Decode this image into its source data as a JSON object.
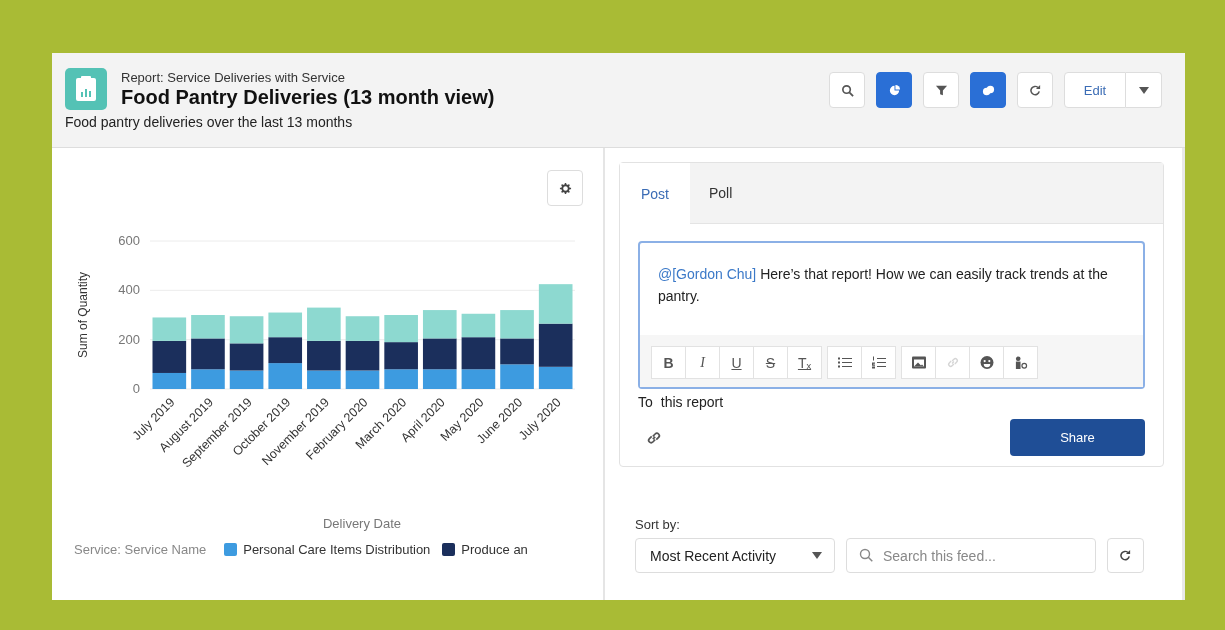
{
  "header": {
    "object_type": "Report: Service Deliveries with Service",
    "title": "Food Pantry Deliveries (13 month view)",
    "description": "Food pantry deliveries over the last 13 months"
  },
  "toolbar": [
    {
      "kind": "search",
      "selected": false
    },
    {
      "kind": "chart",
      "selected": true
    },
    {
      "kind": "filter",
      "selected": false
    },
    {
      "kind": "shapes",
      "selected": true
    },
    {
      "kind": "refresh",
      "selected": false
    }
  ],
  "edit_button": {
    "label": "Edit"
  },
  "chart_panel": {
    "chart_data": {
      "type": "bar",
      "stacked": true,
      "legend": {
        "title": "Service: Service Name"
      },
      "xlabel": "Delivery Date",
      "ylabel": "Sum of Quantity",
      "ylim": [
        0,
        600
      ],
      "yticks": [
        0,
        200,
        400,
        600
      ],
      "categories": [
        "July 2019",
        "August 2019",
        "September 2019",
        "October 2019",
        "November 2019",
        "February 2020",
        "March 2020",
        "April 2020",
        "May 2020",
        "June 2020",
        "July 2020"
      ],
      "series": [
        {
          "name": "Personal Care Items Distribution",
          "color": "#3d9be0",
          "values": [
            65,
            80,
            75,
            105,
            75,
            75,
            80,
            80,
            80,
            100,
            90
          ]
        },
        {
          "name": "Produce an",
          "color": "#1b2f5c",
          "values": [
            130,
            125,
            110,
            105,
            120,
            120,
            110,
            125,
            130,
            105,
            175
          ]
        },
        {
          "color": "#8dd9d0",
          "values": [
            95,
            95,
            110,
            100,
            135,
            100,
            110,
            115,
            95,
            115,
            160
          ]
        }
      ]
    }
  },
  "publisher": {
    "tabs": [
      {
        "label": "Post",
        "selected": true
      },
      {
        "label": "Poll",
        "selected": false
      }
    ],
    "post": {
      "mention": "@[Gordon Chu]",
      "text": " Here’s that report! How we can easily track trends at the pantry."
    },
    "toolbar_groups": [
      [
        {
          "kind": "bold",
          "glyph": "B",
          "disabled": false
        },
        {
          "kind": "italic",
          "glyph": "I",
          "disabled": false
        },
        {
          "kind": "underline",
          "glyph": "U",
          "disabled": false
        },
        {
          "kind": "strikethrough",
          "glyph": "S",
          "disabled": false
        },
        {
          "kind": "clear-format",
          "glyph": "Tₓ",
          "disabled": false
        }
      ],
      [
        {
          "kind": "bullet-list",
          "disabled": false
        },
        {
          "kind": "numbered-list",
          "disabled": false
        }
      ],
      [
        {
          "kind": "image",
          "disabled": false
        },
        {
          "kind": "link",
          "disabled": true
        },
        {
          "kind": "emoji",
          "disabled": false
        },
        {
          "kind": "mention",
          "disabled": false
        }
      ]
    ],
    "to_label": "To",
    "to_value": "this report",
    "share_button": "Share"
  },
  "feed": {
    "sort_label": "Sort by:",
    "sort_value": "Most Recent Activity",
    "search_placeholder": "Search this feed..."
  }
}
